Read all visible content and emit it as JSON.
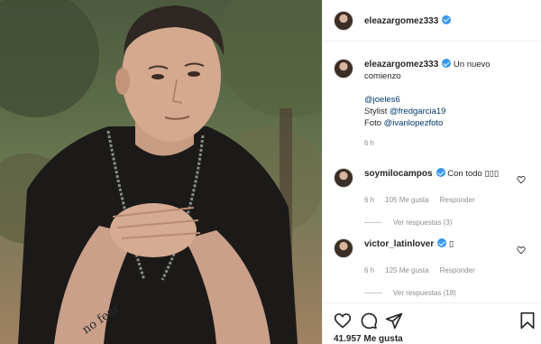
{
  "post": {
    "author": "eleazargomez333",
    "caption": {
      "text": "Un nuevo comienzo",
      "mention_1": "@joeles6",
      "stylist_label": "Stylist",
      "mention_2": "@fredgarcia19",
      "foto_label": "Foto",
      "mention_3": "@ivanlopezfoto",
      "time": "6 h"
    },
    "comments": [
      {
        "user": "soymilocampos",
        "text": "Con todo ▯▯▯",
        "time": "6 h",
        "likes": "105 Me gusta",
        "reply_label": "Responder",
        "view_replies": "Ver respuestas (3)"
      },
      {
        "user": "victor_latinlover",
        "text": "▯",
        "time": "6 h",
        "likes": "125 Me gusta",
        "reply_label": "Responder",
        "view_replies": "Ver respuestas (18)"
      }
    ],
    "likes_text": "41.957 Me gusta",
    "icons": [
      "heart-icon",
      "comment-icon",
      "share-icon",
      "bookmark-icon",
      "verified-icon"
    ],
    "colors": {
      "verified": "#3897f0",
      "link": "#00376b",
      "muted": "#8e8e8e"
    }
  }
}
